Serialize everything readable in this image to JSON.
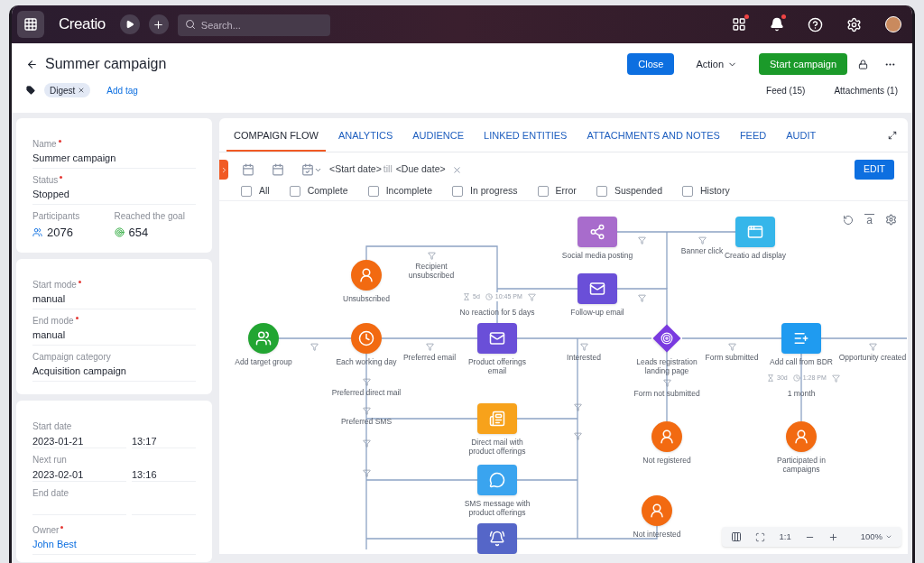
{
  "top_bar": {
    "logo": "Creatio",
    "search": {
      "placeholder": "Search..."
    },
    "apps_alert": true,
    "bell_alert": true
  },
  "header": {
    "title": "Summer campaign",
    "buttons": [
      {
        "kind": "primary",
        "label": "Close"
      },
      {
        "kind": "menu",
        "label": "Action"
      },
      {
        "kind": "success",
        "label": "Start campaign"
      }
    ],
    "tags": [
      {
        "label": "Digest"
      }
    ],
    "add_tag": "Add tag",
    "links": [
      "Feed (15)",
      "Attachments (1)"
    ]
  },
  "cards": [
    {
      "fields": [
        {
          "label": "Name",
          "required": true,
          "value": "Summer campaign"
        },
        {
          "label": "Status",
          "required": true,
          "value": "Stopped"
        }
      ],
      "stats": [
        {
          "kind": "people",
          "label": "Participants",
          "value": "2076"
        },
        {
          "kind": "goal",
          "label": "Reached the goal",
          "value": "654"
        }
      ]
    },
    {
      "fields": [
        {
          "label": "Start mode",
          "required": true,
          "value": "manual"
        },
        {
          "label": "End mode",
          "required": true,
          "value": "manual"
        },
        {
          "label": "Campaign category",
          "required": false,
          "value": "Acquisition campaign"
        }
      ]
    },
    {
      "dates": [
        {
          "label": "Start date",
          "date": "2023-01-21",
          "time": "13:17"
        },
        {
          "label": "Next run",
          "date": "2023-02-01",
          "time": "13:16"
        },
        {
          "label": "End date"
        }
      ],
      "owner": {
        "label": "Owner",
        "required": true,
        "value": "John Best"
      }
    }
  ],
  "tabs": [
    {
      "label": "COMPAIGN FLOW",
      "selected": true
    },
    {
      "label": "ANALYTICS",
      "selected": false
    },
    {
      "label": "AUDIENCE",
      "selected": false
    },
    {
      "label": "LINKED ENTITIES",
      "selected": false
    },
    {
      "label": "ATTACHMENTS AND NOTES",
      "selected": false
    },
    {
      "label": "FEED",
      "selected": false
    },
    {
      "label": "AUDIT",
      "selected": false
    }
  ],
  "period": {
    "start": "<Start date>",
    "till": "till",
    "end": "<Due date>"
  },
  "edit_button": "EDIT",
  "filters": [
    {
      "label": "All",
      "checked": false
    },
    {
      "label": "Complete",
      "checked": false
    },
    {
      "label": "Incomplete",
      "checked": false
    },
    {
      "label": "In progress",
      "checked": false
    },
    {
      "label": "Error",
      "checked": false
    },
    {
      "label": "Suspended",
      "checked": false
    },
    {
      "label": "History",
      "checked": false
    }
  ],
  "flow": {
    "tool_label": "a",
    "nodes": [
      {
        "kind": "square",
        "color": "#a86ccc",
        "label": "Social media posting"
      },
      {
        "kind": "square",
        "color": "#36b6ea",
        "label": "Creatio ad display"
      },
      {
        "kind": "circle",
        "color": "#f26a11",
        "label": "Unsubscribed"
      },
      {
        "kind": "square",
        "color": "#6a4fd8",
        "label": "Follow-up email"
      },
      {
        "kind": "circle",
        "color": "#22a532",
        "label": "Add target group"
      },
      {
        "kind": "circle",
        "color": "#f26a11",
        "label": "Each working day"
      },
      {
        "kind": "square",
        "color": "#6a4fd8",
        "label": "Product offerings email"
      },
      {
        "kind": "diamond",
        "color": "#7a3ae0",
        "label": "Leads registration landing page"
      },
      {
        "kind": "square",
        "color": "#1f9bf0",
        "label": "Add call from BDR"
      },
      {
        "kind": "square",
        "color": "#f7a21b",
        "label": "Direct mail with product offerings"
      },
      {
        "kind": "circle",
        "color": "#f26a11",
        "label": "Not registered"
      },
      {
        "kind": "circle",
        "color": "#f26a11",
        "label": "Participated in campaigns"
      },
      {
        "kind": "square",
        "color": "#3aa4ef",
        "label": "SMS message with product offerings"
      },
      {
        "kind": "circle",
        "color": "#f26a11",
        "label": "Not interested"
      },
      {
        "kind": "square",
        "color": "#5566c8"
      }
    ],
    "conditions": [
      {
        "label": "Banner click"
      },
      {
        "label": "Recipient unsubscribed"
      },
      {
        "label": "No reaction for 5 days",
        "wait": "5d",
        "time": "10:45 PM"
      },
      {
        "label": "Preferred email"
      },
      {
        "label": "Interested"
      },
      {
        "label": "Form submitted"
      },
      {
        "label": "Opportunity created"
      },
      {
        "label": "Preferred direct mail"
      },
      {
        "label": "Form not submitted"
      },
      {
        "label": "1 month",
        "wait": "30d",
        "time": "1:28 PM"
      },
      {
        "label": "Preferred SMS"
      }
    ],
    "zoom": {
      "ratio": "1:1",
      "level": "100%"
    }
  }
}
